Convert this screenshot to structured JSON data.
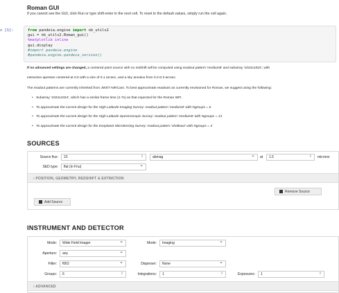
{
  "header": {
    "title": "Roman GUI",
    "subtitle": "If you cannot see the GUI, click Run or type shift-enter in the next cell. To reset to the default values, simply run the cell again."
  },
  "code_cell": {
    "prompt": "s [1]:",
    "line1_kw1": "from",
    "line1_mod": " pandeia.engine ",
    "line1_kw2": "import",
    "line1_rest": " nb_utils2",
    "line2": "gui = nb_utils2.Roman_gui()",
    "line3": "%matplotlib inline",
    "line4": "gui.display",
    "line5": "#import pandeia.engine",
    "line6": "#pandeia.engine.pandeia_version()"
  },
  "notes": {
    "p1_bold": "If no advanced settings are changed,",
    "p1_rest": " a centered point source with no redshift will be computed using readout pattern 'medium8' and subarray '1024x1024', with",
    "p1_line2": "extraction aperture centered at 0,0 with a size of 0.1 arcsec, and a sky annulus from 0.2-0.3 arcsec.",
    "p2": "The readout patterns are currently inherited from JWST NIRCam. To best approximate readouts as currently envisioned for Roman, we suggest using the following:",
    "bullets": [
      "Subarray '1024x1024', which has a similar frame time (2.7s) as that expected for the Roman WFI.",
      "To approximate the current design for the High Latitude Imaging Survey: readout pattern 'medium8' with Ngroups = 6",
      "To approximate the current design for the High Latitude Spectroscopic Survey: readout pattern 'medium8' with Ngroups = 13",
      "To approximate the current design for the Exoplanet Microlensing Survey: readout pattern 'shallow2' with Ngroups = 4"
    ],
    "bullet_italic_prefixes": [
      "",
      "To approximate the current design for the High Latitude Imaging Survey:",
      "To approximate the current design for the High Latitude Spectroscopic Survey:",
      "To approximate the current design for the Exoplanet Microlensing Survey:"
    ]
  },
  "sources": {
    "heading": "SOURCES",
    "source_flux_label": "Source flux:",
    "source_flux_value": "23",
    "flux_unit_value": "abmag",
    "at_label": "at",
    "wavelength_value": "1.5",
    "wavelength_unit": "microns",
    "sed_type_label": "SED type:",
    "sed_type_value": "flat (in Fnu)",
    "accordion_label": "› POSITION, GEOMETRY, REDSHIFT & EXTINCTION",
    "remove_source_label": "Remove Source",
    "add_source_label": "Add Source"
  },
  "instrument": {
    "heading": "INSTRUMENT AND DETECTOR",
    "mode_label": "Mode:",
    "mode_value": "Wide Field Imager",
    "mode2_label": "Mode:",
    "mode2_value": "Imaging",
    "aperture_label": "Aperture:",
    "aperture_value": "any",
    "filter_label": "Filter:",
    "filter_value": "f062",
    "disperser_label": "Disperser:",
    "disperser_value": "None",
    "groups_label": "Groups:",
    "groups_value": "6",
    "integrations_label": "Integrations:",
    "integrations_value": "1",
    "exposures_label": "Exposures:",
    "exposures_value": "1",
    "advanced_label": "› ADVANCED"
  }
}
